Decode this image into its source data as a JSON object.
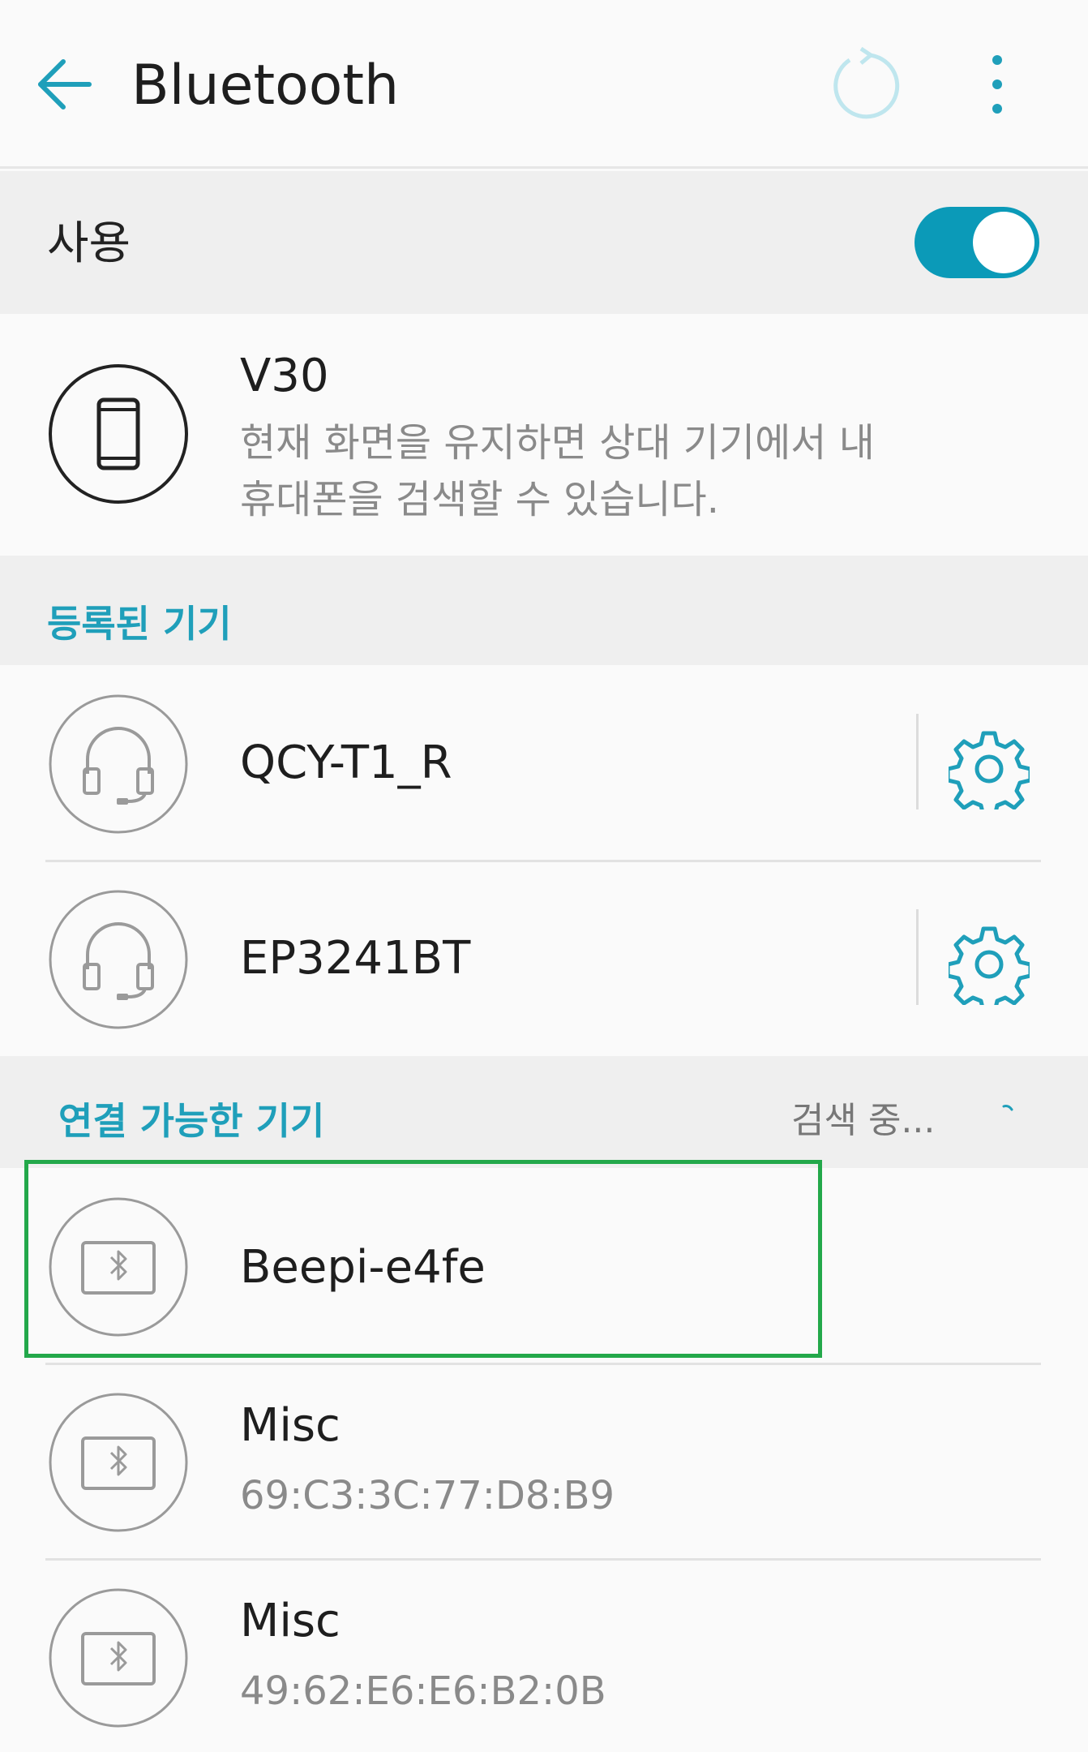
{
  "app_bar": {
    "title": "Bluetooth",
    "back_icon": "arrow-left-icon",
    "refresh_icon": "refresh-icon",
    "more_icon": "more-vertical-icon",
    "accent_color": "#1f9fba"
  },
  "bluetooth_toggle": {
    "label": "사용",
    "state": "on",
    "color": "#0b9ab8"
  },
  "visibility": {
    "device_name": "V30",
    "description_line1": "현재 화면을 유지하면 상대 기기에서 내",
    "description_line2": "휴대폰을 검색할 수 있습니다.",
    "icon": "phone-icon"
  },
  "paired_section": {
    "title": "등록된 기기",
    "devices": [
      {
        "name": "QCY-T1_R",
        "icon": "headset-icon",
        "settings_icon": "gear-icon"
      },
      {
        "name": "EP3241BT",
        "icon": "headset-icon",
        "settings_icon": "gear-icon"
      }
    ]
  },
  "available_section": {
    "title": "연결 가능한 기기",
    "status": "검색 중...",
    "devices": [
      {
        "name": "Beepi-e4fe",
        "address": "",
        "icon": "bluetooth-icon"
      },
      {
        "name": "Misc",
        "address": "69:C3:3C:77:D8:B9",
        "icon": "bluetooth-icon"
      },
      {
        "name": "Misc",
        "address": "49:62:E6:E6:B2:0B",
        "icon": "bluetooth-icon"
      }
    ]
  },
  "highlight_color": "#23a84a"
}
